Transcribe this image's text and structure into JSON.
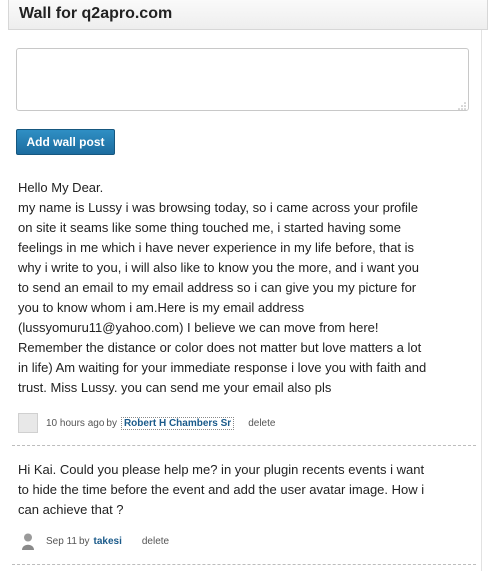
{
  "wall": {
    "title": "Wall for q2apro.com"
  },
  "composer": {
    "value": "",
    "button_label": "Add wall post"
  },
  "posts": [
    {
      "lines": [
        "Hello My Dear.",
        "my name is Lussy i was browsing today, so i came across your profile",
        "on site it seams like some thing touched me, i started having some",
        "feelings in me which i have never experience in my life before, that is",
        "why i write to you, i will also like to know you the more, and i want you",
        "to send an email to my email address so i can give you my picture for",
        "you to know whom i am.Here is my email address",
        "(lussyomuru11@yahoo.com) I believe we can move from here!",
        "Remember the distance or color does not matter but love matters a lot",
        "in life) Am waiting for your immediate response i love you with faith and",
        "trust. Miss Lussy. you can send me your email also pls"
      ],
      "time": "10 hours ago",
      "by": "by",
      "author": "Robert H Chambers Sr",
      "delete_label": "delete"
    },
    {
      "lines": [
        "Hi Kai. Could you please help me? in your plugin recents events  i want",
        "to hide the time before the event and add the user avatar image. How i",
        "can achieve that ?"
      ],
      "time": "Sep 11",
      "by": "by",
      "author": "takesi",
      "delete_label": "delete"
    }
  ],
  "icons": {
    "grip": "resize-grip-icon",
    "avatar_1": "blank-avatar-icon",
    "avatar_2": "person-silhouette-icon"
  },
  "colors": {
    "button": "#1f74a8",
    "link": "#1a5a8a",
    "text": "#222222"
  }
}
